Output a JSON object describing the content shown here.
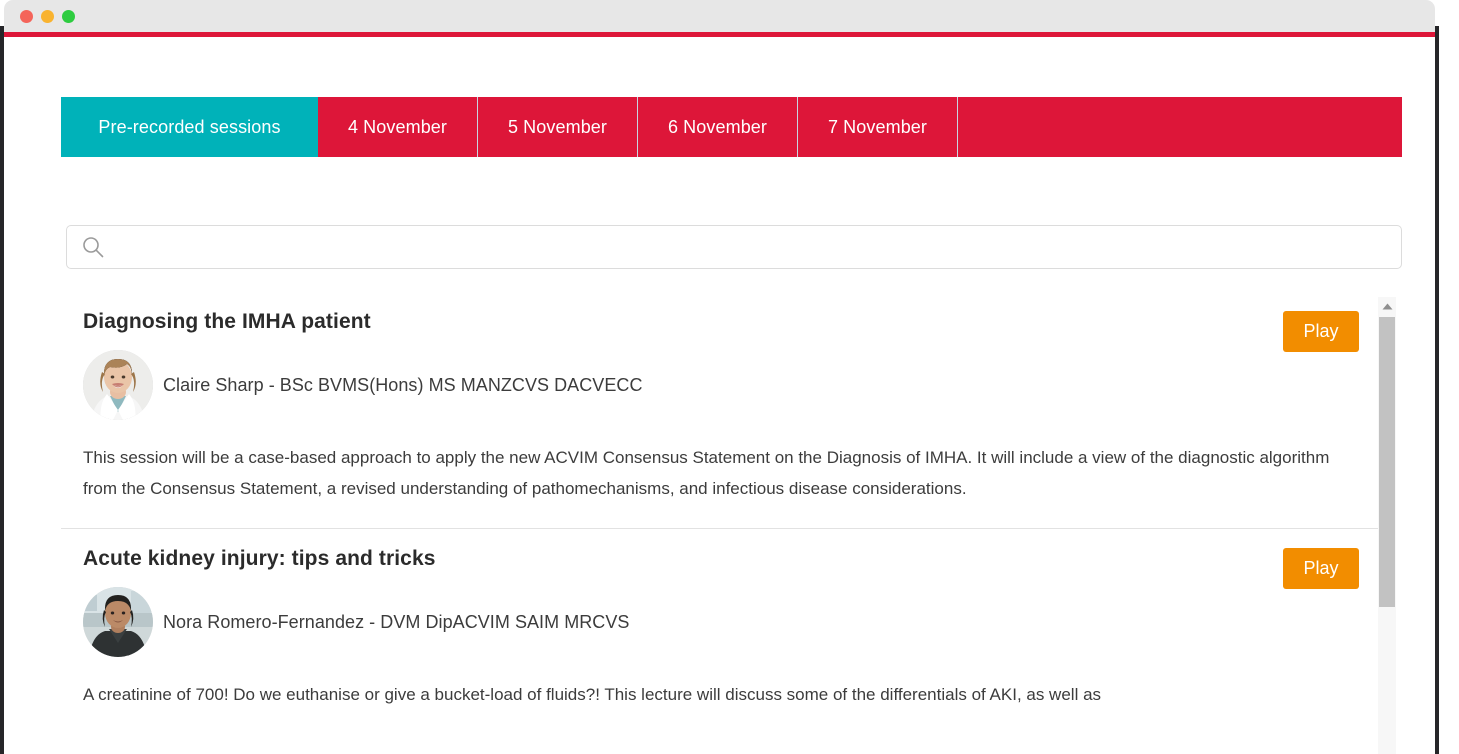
{
  "window": {
    "traffic_lights": [
      "close",
      "minimize",
      "maximize"
    ],
    "accent_color": "#dd1639",
    "frame_color": "#262629"
  },
  "tabs": {
    "active_index": 0,
    "active_color": "#00b2b9",
    "inactive_color": "#dd1639",
    "items": [
      {
        "label": "Pre-recorded sessions"
      },
      {
        "label": "4 November"
      },
      {
        "label": "5 November"
      },
      {
        "label": "6 November"
      },
      {
        "label": "7 November"
      }
    ]
  },
  "search": {
    "icon": "search-icon",
    "value": "",
    "placeholder": ""
  },
  "sessions": [
    {
      "title": "Diagnosing the IMHA patient",
      "play_label": "Play",
      "speaker": "Claire Sharp - BSc BVMS(Hons) MS MANZCVS DACVECC",
      "description": "This session will be a case-based approach to apply the new ACVIM Consensus Statement on the Diagnosis of IMHA. It will include a view of the diagnostic algorithm from the Consensus Statement, a revised understanding of pathomechanisms, and infectious disease considerations."
    },
    {
      "title": "Acute kidney injury: tips and tricks",
      "play_label": "Play",
      "speaker": "Nora Romero-Fernandez - DVM DipACVIM SAIM MRCVS",
      "description": "A creatinine of 700! Do we euthanise or give a bucket-load of fluids?! This lecture will discuss some of the differentials of AKI, as well as"
    }
  ],
  "scrollbar": {
    "up_arrow": "triangle-up-icon",
    "thumb_color": "#c2c2c2"
  },
  "colors": {
    "play_button": "#f28d00",
    "tab_active": "#00b2b9",
    "tab_inactive": "#dd1639"
  }
}
